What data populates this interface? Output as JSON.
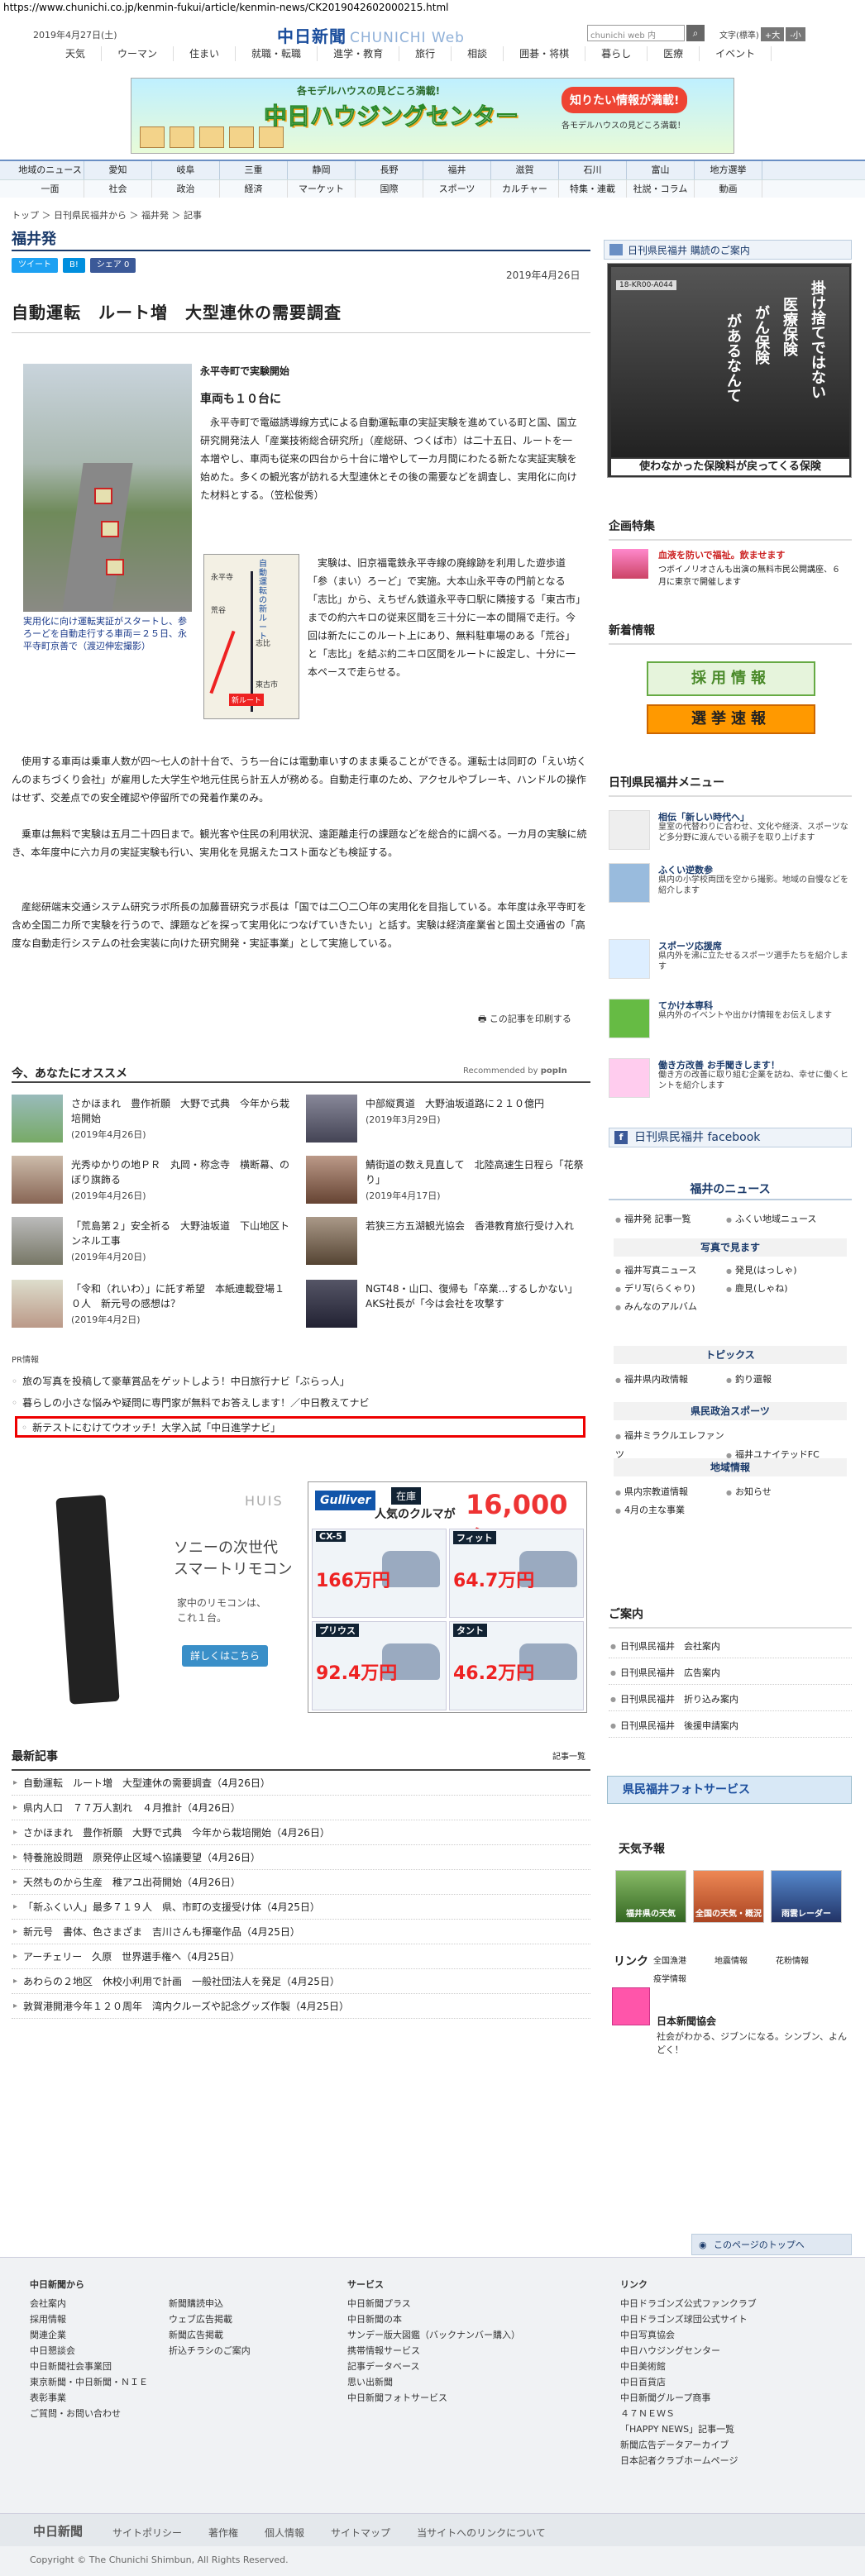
{
  "url": "https://www.chunichi.co.jp/kenmin-fukui/article/kenmin-news/CK2019042602000215.html",
  "header": {
    "date": "2019年4月27日(土)",
    "logo": "中日新聞",
    "logo_web": "CHUNICHI Web",
    "search_placeholder": "chunichi web 内",
    "fontsize_label": "文字",
    "fontsize_buttons": [
      "標準",
      "+大",
      "-小"
    ],
    "nav": [
      "天気",
      "ウーマン",
      "住まい",
      "就職・転職",
      "進学・教育",
      "旅行",
      "相談",
      "囲碁・将棋",
      "暮らし",
      "医療",
      "イベント"
    ]
  },
  "banner": {
    "title": "中日ハウジングセンター",
    "sub": "各モデルハウスの見どころ満載!",
    "cta": "知りたい情報が満載!",
    "note": "各モデルハウスの見どころ満載！"
  },
  "nav_blue": {
    "row1": [
      "地域のニュース",
      "愛知",
      "岐阜",
      "三重",
      "静岡",
      "長野",
      "福井",
      "滋賀",
      "石川",
      "富山",
      "地方選挙"
    ],
    "row2": [
      "一面",
      "社会",
      "政治",
      "経済",
      "マーケット",
      "国際",
      "スポーツ",
      "カルチャー",
      "特集・連載",
      "社説・コラム",
      "動画"
    ]
  },
  "breadcrumb": "トップ ＞ 日刊県民福井から ＞ 福井発 ＞ 記事",
  "section_title": "福井発",
  "social": {
    "tweet": "ツイート",
    "hatena": "B!",
    "share": "シェア 0"
  },
  "article": {
    "date": "2019年4月26日",
    "title": "自動運転　ルート増　大型連休の需要調査",
    "photo_caption": "実用化に向け運転実証がスタートし、参ろーどを自動走行する車両＝２５日、永平寺町京善で（渡辺伸宏撮影）",
    "sub_location": "永平寺町で実験開始",
    "sub_head": "車両も１０台に",
    "para1": "　永平寺町で電磁誘導線方式による自動運転車の実証実験を進めている町と国、国立研究開発法人「産業技術総合研究所」（産総研、つくば市）は二十五日、ルートを一本増やし、車両も従来の四台から十台に増やして一カ月間にわたる新たな実証実験を始めた。多くの観光客が訪れる大型連休とその後の需要などを調査し、実用化に向けた材料とする。（笠松俊秀）",
    "map_title": "自動運転の新ルート",
    "map_labels": [
      "永平寺",
      "荒谷",
      "志比",
      "東古市",
      "新ルート"
    ],
    "para2": "　実験は、旧京福電鉄永平寺線の廃線跡を利用した遊歩道「参（まい）ろーど」で実施。大本山永平寺の門前となる「志比」から、えちぜん鉄道永平寺口駅に隣接する「東古市」までの約六キロの従来区間を三十分に一本の間隔で走行。今回は新たにこのルート上にあり、無料駐車場のある「荒谷」と「志比」を結ぶ約二キロ区間をルートに設定し、十分に一本ペースで走らせる。",
    "para3": "　使用する車両は乗車人数が四〜七人の計十台で、うち一台には電動車いすのまま乗ることができる。運転士は同町の「えい坊くんのまちづくり会社」が雇用した大学生や地元住民ら計五人が務める。自動走行車のため、アクセルやブレーキ、ハンドルの操作はせず、交差点での安全確認や停留所での発着作業のみ。",
    "para4": "　乗車は無料で実験は五月二十四日まで。観光客や住民の利用状況、遠距離走行の課題などを総合的に調べる。一カ月の実験に続き、本年度中に六カ月の実証実験も行い、実用化を見据えたコスト面なども検証する。",
    "para5": "　産総研端末交通システム研究ラボ所長の加藤晋研究ラボ長は「国では二〇二〇年の実用化を目指している。本年度は永平寺町を含め全国二カ所で実験を行うので、課題などを探って実用化につなげていきたい」と話す。実験は経済産業省と国土交通省の「高度な自動走行システムの社会実装に向けた研究開発・実証事業」として実施している。",
    "print": "この記事を印刷する"
  },
  "recommend": {
    "head": "今、あなたにオススメ",
    "by": "Recommended by",
    "brand": "popIn",
    "items": [
      {
        "title": "さかほまれ　豊作祈願　大野で式典　今年から栽培開始",
        "date": "(2019年4月26日)"
      },
      {
        "title": "中部縦貫道　大野油坂道路に２１０億円",
        "date": "(2019年3月29日)"
      },
      {
        "title": "光秀ゆかりの地ＰＲ　丸岡・称念寺　横断幕、のぼり旗飾る",
        "date": "(2019年4月26日)"
      },
      {
        "title": "鯖街道の数え見直して　北陸高速生日程ら「花祭り」",
        "date": "(2019年4月17日)"
      },
      {
        "title": "「荒島第２」安全祈る　大野油坂道　下山地区トンネル工事",
        "date": "(2019年4月20日)"
      },
      {
        "title": "若狭三方五湖観光協会　香港教育旅行受け入れ",
        "date": ""
      },
      {
        "title": "「令和（れいわ）」に託す希望　本紙連載登場１０人　新元号の感想は？",
        "date": "(2019年4月2日)"
      },
      {
        "title": "NGT48・山口、復帰も「卒業…するしかない」　AKS社長が「今は会社を攻撃す",
        "date": ""
      }
    ]
  },
  "pr": {
    "head": "PR情報",
    "lines": [
      "旅の写真を投稿して豪華賞品をゲットしよう！中日旅行ナビ「ぶらっ人」",
      "暮らしの小さな悩みや疑問に専門家が無料でお答えします！／中日教えてナビ",
      "新テストにむけてウオッチ！大学入試「中日進学ナビ」"
    ]
  },
  "ad_sony": {
    "brand": "HUIS",
    "l1": "ソニーの次世代",
    "l2": "スマートリモコン",
    "l3": "家中のリモコンは、",
    "l4": "これ１台。",
    "btn": "詳しくはこちら"
  },
  "ad_gulliver": {
    "logo": "Gulliver",
    "stock": "在庫",
    "txt": "人気のクルマが",
    "num": "16,000台",
    "cars": [
      {
        "name": "CX-5",
        "price": "166万円"
      },
      {
        "name": "フィット",
        "price": "64.7万円"
      },
      {
        "name": "プリウス",
        "price": "92.4万円"
      },
      {
        "name": "タント",
        "price": "46.2万円"
      }
    ]
  },
  "latest": {
    "head": "最新記事",
    "more": "記事一覧",
    "items": [
      "自動運転　ルート増　大型連休の需要調査（4月26日）",
      "県内人口　７７万人割れ　４月推計（4月26日）",
      "さかほまれ　豊作祈願　大野で式典　今年から栽培開始（4月26日）",
      "特養施設問題　原発停止区域へ協議要望（4月26日）",
      "天然ものから生産　稚アユ出荷開始（4月26日）",
      "「新ふくい人」最多７１９人　県、市町の支援受け体（4月25日）",
      "新元号　書体、色さまざま　吉川さんも揮毫作品（4月25日）",
      "アーチェリー　久原　世界選手権へ（4月25日）",
      "あわらの２地区　休校小利用で計画　一般社団法人を発足（4月25日）",
      "敦賀港開港今年１２０周年　湾内クルーズや記念グッズ作製（4月25日）"
    ]
  },
  "sidebar": {
    "subscribe": "日刊県民福井 購読のご案内",
    "ad_tag": "18-KR00-A044",
    "ad_v1": "掛け捨てではない",
    "ad_v2": "医療保険",
    "ad_v3": "がん保険",
    "ad_v4": "があるなんて",
    "ad_foot": "使わなかった保険料が戻ってくる保険",
    "kikaku_head": "企画特集",
    "kikaku_title": "血液を防いで福祉。飲ませます",
    "kikaku_desc": "つボイノリオさんも出演の無料市民公開講座、６月に東京で開催します",
    "jobs_head": "新着情報",
    "recruit": "採用情報",
    "election": "選挙速報",
    "menu_head": "日刊県民福井メニュー",
    "menu": [
      {
        "t": "相伝「新しい時代へ」",
        "d": "皇室の代替わりに合わせ、文化や経済、スポーツなど多分野に渡んでいる親子を取り上げます"
      },
      {
        "t": "ふくい逆数参",
        "d": "県内の小学校両団を空から撮影。地域の自慢などを紹介します"
      },
      {
        "t": "スポーツ応援席",
        "d": "県内外を沸に立たせるスポーツ選手たちを紹介します"
      },
      {
        "t": "てかけ本専科",
        "d": "県内外のイベントや出かけ情報をお伝えします"
      },
      {
        "t": "働き方改善 お手聞きします！",
        "d": "働き方の改善に取り組む企業を訪ね、幸せに働くヒントを紹介します"
      }
    ],
    "facebook": "日刊県民福井 facebook",
    "fn_head": "福井のニュース",
    "fn_row1": [
      "福井発 記事一覧",
      "ふくい地域ニュース"
    ],
    "photo_head": "写真で見ます",
    "fn_row2": [
      "福井写真ニュース",
      "発見(はっしゃ)",
      "デリ写(らくゃり)",
      "鹿見(しゃね)",
      "みんなのアルバム"
    ],
    "topics_head": "トピックス",
    "fn_row3": [
      "福井県内政情報",
      "釣り還報"
    ],
    "sports_head": "県民政治スポーツ",
    "fn_row4": [
      "福井ミラクルエレファンツ",
      "福井ユナイテッドFC"
    ],
    "local_head": "地域情報",
    "fn_row5": [
      "県内宗教道情報",
      "お知らせ",
      "4月の主な事業"
    ],
    "guide_head": "ご案内",
    "guide": [
      "日刊県民福井　会社案内",
      "日刊県民福井　広告案内",
      "日刊県民福井　折り込み案内",
      "日刊県民福井　後援申請案内"
    ],
    "photo_service": "県民福井フォトサービス",
    "weather_head": "天気予報",
    "weather": [
      "福井県の天気",
      "全国の天気・概況",
      "雨雲レーダー"
    ],
    "link_head": "リンク",
    "links": [
      "全国漁港",
      "地震情報",
      "花粉情報",
      "疫学情報"
    ],
    "jhead": "日本新聞協会",
    "jdesc": "社会がわかる、ジブンになる。シンブン、よんどく！"
  },
  "pagetop": "このページのトップへ",
  "footer": {
    "c1h": "中日新聞から",
    "c1": [
      "会社案内",
      "採用情報",
      "関連企業",
      "中日懇談会",
      "中日新聞社会事業団",
      "東京新聞・中日新聞・ＮＩＥ",
      "表彰事業",
      "ご質問・お問い合わせ"
    ],
    "c2": [
      "新聞購読申込",
      "ウェブ広告掲載",
      "新聞広告掲載",
      "折込チラシのご案内"
    ],
    "c3h": "サービス",
    "c3": [
      "中日新聞プラス",
      "中日新聞の本",
      "サンデー版大図鑑（バックナンバー購入）",
      "携帯情報サービス",
      "記事データベース",
      "思い出新聞",
      "中日新聞フォトサービス"
    ],
    "c4h": "リンク",
    "c4": [
      "中日ドラゴンズ公式ファンクラブ",
      "中日ドラゴンズ球団公式サイト",
      "中日写真協会",
      "中日ハウジングセンター",
      "中日美術館",
      "中日百貨店",
      "中日新聞グループ商事",
      "４７ＮＥＷＳ",
      "「HAPPY NEWS」記事一覧",
      "新聞広告データアーカイブ",
      "日本記者クラブホームページ"
    ],
    "logo": "中日新聞",
    "links": [
      "サイトポリシー",
      "著作権",
      "個人情報",
      "サイトマップ",
      "当サイトへのリンクについて"
    ],
    "copyright": "Copyright © The Chunichi Shimbun, All Rights Reserved."
  }
}
